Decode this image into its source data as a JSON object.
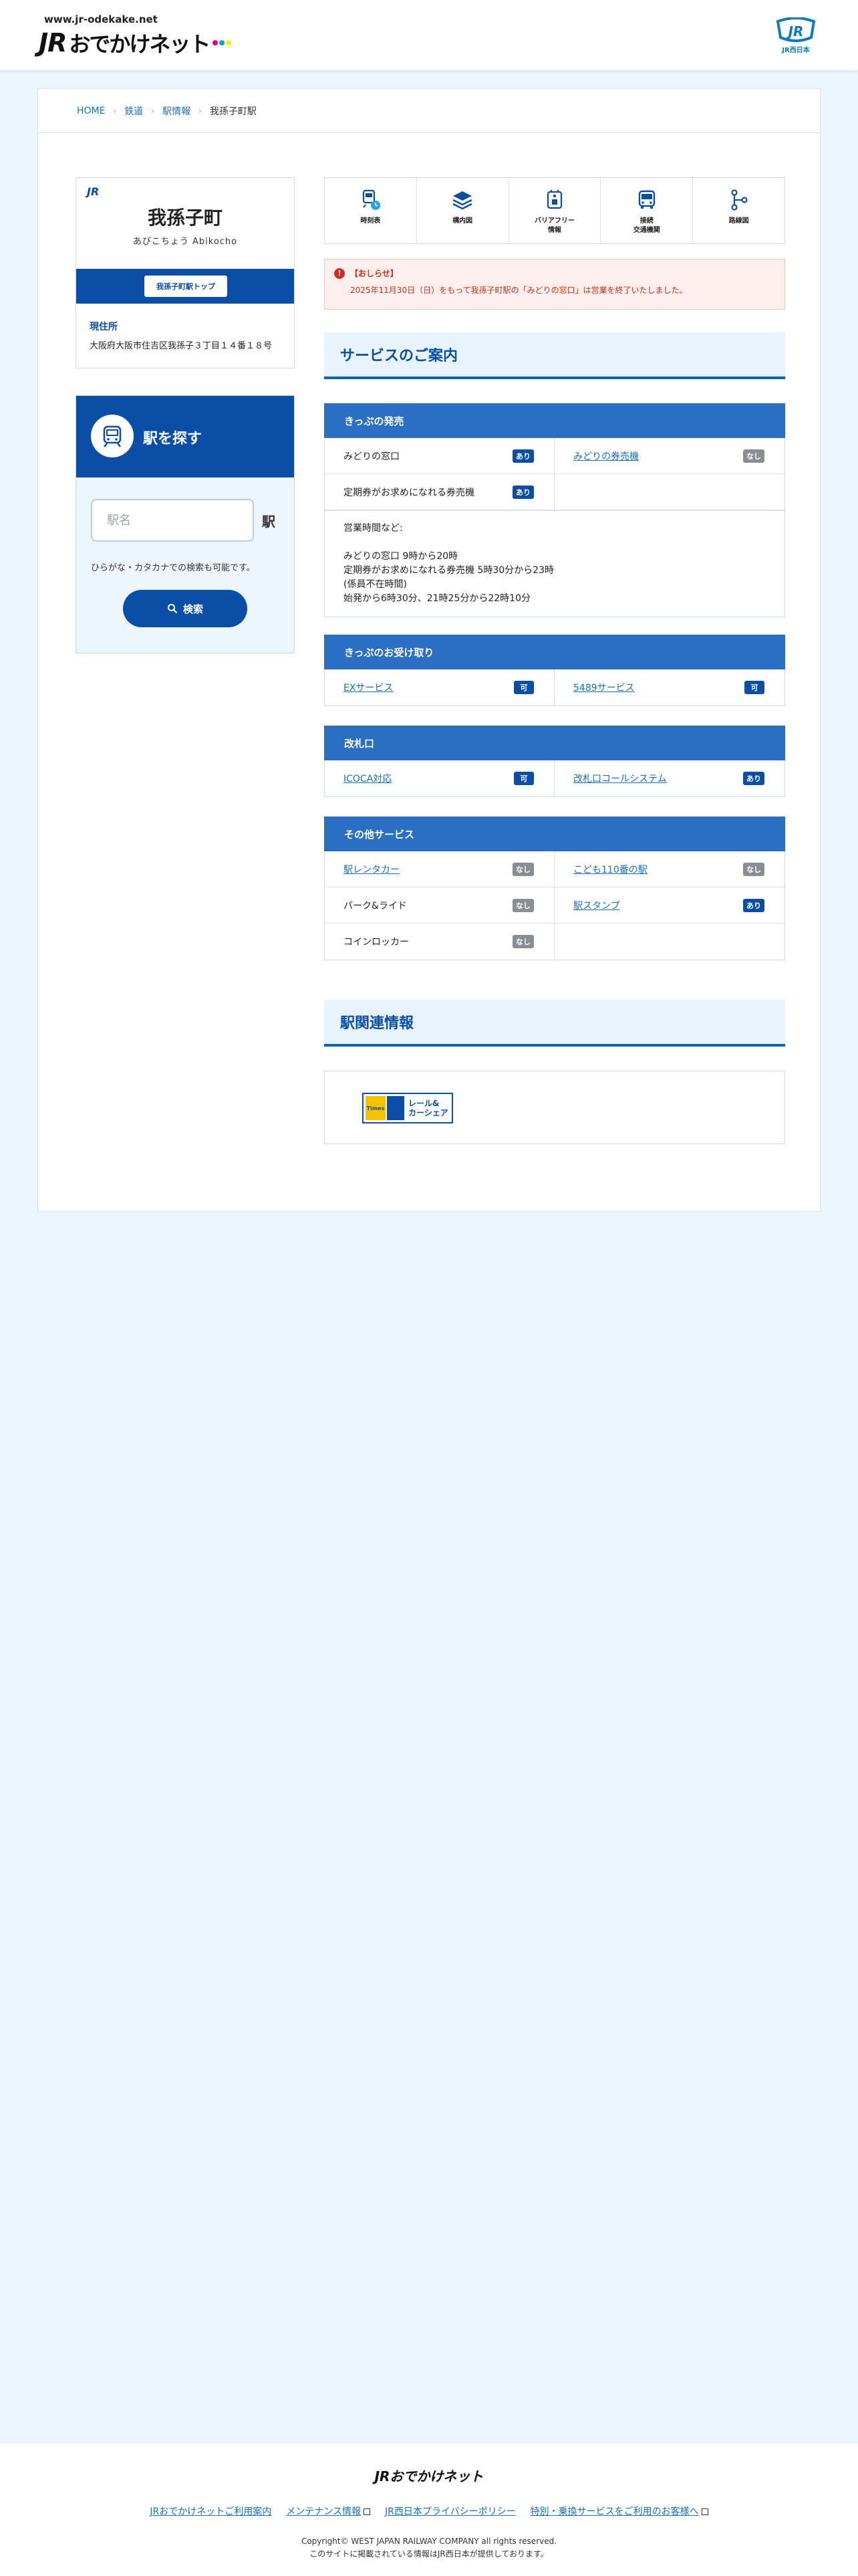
{
  "header": {
    "url": "www.jr-odekake.net",
    "logo_jr": "JR",
    "logo_kana": "おでかけネット",
    "jr_west_mark": "JR",
    "jr_west_label": "JR西日本"
  },
  "breadcrumb": {
    "items": [
      "HOME",
      "鉄道",
      "駅情報"
    ],
    "current": "我孫子町駅"
  },
  "station": {
    "mark": "JR",
    "name": "我孫子町",
    "reading": "あびこちょう  Abikocho",
    "top_button": "我孫子町駅トップ",
    "address_label": "現住所",
    "address": "大阪府大阪市住吉区我孫子３丁目１４番１８号"
  },
  "search": {
    "title": "駅を探す",
    "placeholder": "駅名",
    "suffix": "駅",
    "hint": "ひらがな・カタカナでの検索も可能です。",
    "button": "検索"
  },
  "quicknav": [
    {
      "label": "時刻表",
      "icon": "timetable-icon"
    },
    {
      "label": "構内図",
      "icon": "layers-icon"
    },
    {
      "label": "バリアフリー\n情報",
      "icon": "barrier-free-icon"
    },
    {
      "label": "接続\n交通機関",
      "icon": "bus-icon"
    },
    {
      "label": "路線図",
      "icon": "route-map-icon"
    }
  ],
  "notice": {
    "title": "【おしらせ】",
    "body": "2025年11月30日（日）をもって我孫子町駅の「みどりの窓口」は営業を終了いたしました。"
  },
  "services_heading": "サービスのご案内",
  "service_blocks": [
    {
      "title": "きっぷの発売",
      "rows": [
        [
          {
            "label": "みどりの窓口",
            "link": false,
            "badge": "あり",
            "avail": true
          },
          {
            "label": "みどりの券売機",
            "link": true,
            "badge": "なし",
            "avail": false
          }
        ],
        [
          {
            "label": "定期券がお求めになれる券売機",
            "link": false,
            "badge": "あり",
            "avail": true
          },
          {
            "label": "",
            "link": false,
            "badge": "",
            "avail": false
          }
        ]
      ],
      "note": "営業時間など:\n\nみどりの窓口 9時から20時\n定期券がお求めになれる券売機 5時30分から23時\n(係員不在時間)\n始発から6時30分、21時25分から22時10分"
    },
    {
      "title": "きっぷのお受け取り",
      "rows": [
        [
          {
            "label": "EXサービス",
            "link": true,
            "badge": "可",
            "avail": true
          },
          {
            "label": "5489サービス",
            "link": true,
            "badge": "可",
            "avail": true
          }
        ]
      ],
      "note": ""
    },
    {
      "title": "改札口",
      "rows": [
        [
          {
            "label": "ICOCA対応",
            "link": true,
            "badge": "可",
            "avail": true
          },
          {
            "label": "改札口コールシステム",
            "link": true,
            "badge": "あり",
            "avail": true
          }
        ]
      ],
      "note": ""
    },
    {
      "title": "その他サービス",
      "rows": [
        [
          {
            "label": "駅レンタカー",
            "link": true,
            "badge": "なし",
            "avail": false
          },
          {
            "label": "こども110番の駅",
            "link": true,
            "badge": "なし",
            "avail": false
          }
        ],
        [
          {
            "label": "パーク&ライド",
            "link": false,
            "badge": "なし",
            "avail": false
          },
          {
            "label": "駅スタンプ",
            "link": true,
            "badge": "あり",
            "avail": true
          }
        ],
        [
          {
            "label": "コインロッカー",
            "link": false,
            "badge": "なし",
            "avail": false
          },
          {
            "label": "",
            "link": false,
            "badge": "",
            "avail": false
          }
        ]
      ],
      "note": ""
    }
  ],
  "related_heading": "駅関連情報",
  "related_banner": {
    "text": "レール&\nカーシェア",
    "brand": "Times"
  },
  "footer": {
    "logo": "JRおでかけネット",
    "links": [
      "JRおでかけネットご利用案内",
      "メンテナンス情報",
      "JR西日本プライバシーポリシー",
      "特別・乗換サービスをご利用のお客様へ"
    ],
    "copyright": "Copyright© WEST JAPAN RAILWAY COMPANY all rights reserved.",
    "notice": "このサイトに掲載されている情報はJR西日本が提供しております。"
  },
  "colors": {
    "brand": "#0a4ea7",
    "service_head": "#2a6fc1",
    "alert": "#d52b1e",
    "page_bg": "#eaf5fd"
  }
}
